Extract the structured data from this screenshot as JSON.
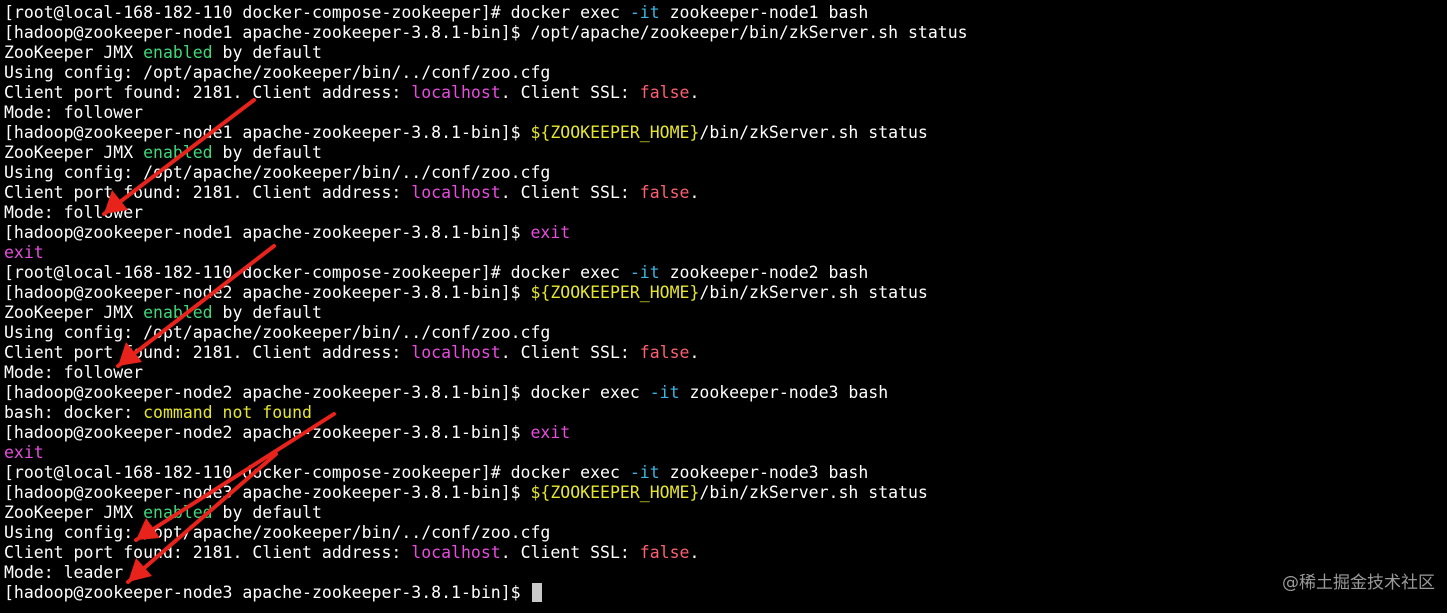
{
  "terminal": {
    "background": "#000000",
    "colors": {
      "default": "#ffffff",
      "green": "#3fd97a",
      "magenta": "#e84de0",
      "red": "#ff5f6e",
      "cyan": "#38b7e6",
      "yellow": "#e6e62e",
      "cursor": "#c8c8c8",
      "arrow": "#e8231b"
    },
    "lines": [
      {
        "segments": [
          {
            "text": "[root@local-168-182-110 docker-compose-zookeeper]# docker exec ",
            "color": "default"
          },
          {
            "text": "-it",
            "color": "cyan"
          },
          {
            "text": " zookeeper-node1 bash",
            "color": "default"
          }
        ]
      },
      {
        "segments": [
          {
            "text": "[hadoop@zookeeper-node1 apache-zookeeper-3.8.1-bin]$ /opt/apache/zookeeper/bin/zkServer.sh status",
            "color": "default"
          }
        ]
      },
      {
        "segments": [
          {
            "text": "ZooKeeper JMX ",
            "color": "default"
          },
          {
            "text": "enabled",
            "color": "green"
          },
          {
            "text": " by default",
            "color": "default"
          }
        ]
      },
      {
        "segments": [
          {
            "text": "Using config: /opt/apache/zookeeper/bin/../conf/zoo.cfg",
            "color": "default"
          }
        ]
      },
      {
        "segments": [
          {
            "text": "Client port found: 2181. Client address: ",
            "color": "default"
          },
          {
            "text": "localhost",
            "color": "magenta"
          },
          {
            "text": ". Client SSL: ",
            "color": "default"
          },
          {
            "text": "false",
            "color": "red"
          },
          {
            "text": ".",
            "color": "default"
          }
        ]
      },
      {
        "segments": [
          {
            "text": "Mode: follower",
            "color": "default"
          }
        ]
      },
      {
        "segments": [
          {
            "text": "[hadoop@zookeeper-node1 apache-zookeeper-3.8.1-bin]$ ",
            "color": "default"
          },
          {
            "text": "${ZOOKEEPER_HOME}",
            "color": "yellow"
          },
          {
            "text": "/bin/zkServer.sh status",
            "color": "default"
          }
        ]
      },
      {
        "segments": [
          {
            "text": "ZooKeeper JMX ",
            "color": "default"
          },
          {
            "text": "enabled",
            "color": "green"
          },
          {
            "text": " by default",
            "color": "default"
          }
        ]
      },
      {
        "segments": [
          {
            "text": "Using config: /opt/apache/zookeeper/bin/../conf/zoo.cfg",
            "color": "default"
          }
        ]
      },
      {
        "segments": [
          {
            "text": "Client port found: 2181. Client address: ",
            "color": "default"
          },
          {
            "text": "localhost",
            "color": "magenta"
          },
          {
            "text": ". Client SSL: ",
            "color": "default"
          },
          {
            "text": "false",
            "color": "red"
          },
          {
            "text": ".",
            "color": "default"
          }
        ]
      },
      {
        "segments": [
          {
            "text": "Mode: follower",
            "color": "default"
          }
        ]
      },
      {
        "segments": [
          {
            "text": "[hadoop@zookeeper-node1 apache-zookeeper-3.8.1-bin]$ ",
            "color": "default"
          },
          {
            "text": "exit",
            "color": "magenta"
          }
        ]
      },
      {
        "segments": [
          {
            "text": "exit",
            "color": "magenta"
          }
        ]
      },
      {
        "segments": [
          {
            "text": "[root@local-168-182-110 docker-compose-zookeeper]# docker exec ",
            "color": "default"
          },
          {
            "text": "-it",
            "color": "cyan"
          },
          {
            "text": " zookeeper-node2 bash",
            "color": "default"
          }
        ]
      },
      {
        "segments": [
          {
            "text": "[hadoop@zookeeper-node2 apache-zookeeper-3.8.1-bin]$ ",
            "color": "default"
          },
          {
            "text": "${ZOOKEEPER_HOME}",
            "color": "yellow"
          },
          {
            "text": "/bin/zkServer.sh status",
            "color": "default"
          }
        ]
      },
      {
        "segments": [
          {
            "text": "ZooKeeper JMX ",
            "color": "default"
          },
          {
            "text": "enabled",
            "color": "green"
          },
          {
            "text": " by default",
            "color": "default"
          }
        ]
      },
      {
        "segments": [
          {
            "text": "Using config: /opt/apache/zookeeper/bin/../conf/zoo.cfg",
            "color": "default"
          }
        ]
      },
      {
        "segments": [
          {
            "text": "Client port found: 2181. Client address: ",
            "color": "default"
          },
          {
            "text": "localhost",
            "color": "magenta"
          },
          {
            "text": ". Client SSL: ",
            "color": "default"
          },
          {
            "text": "false",
            "color": "red"
          },
          {
            "text": ".",
            "color": "default"
          }
        ]
      },
      {
        "segments": [
          {
            "text": "Mode: follower",
            "color": "default"
          }
        ]
      },
      {
        "segments": [
          {
            "text": "[hadoop@zookeeper-node2 apache-zookeeper-3.8.1-bin]$ docker exec ",
            "color": "default"
          },
          {
            "text": "-it",
            "color": "cyan"
          },
          {
            "text": " zookeeper-node3 bash",
            "color": "default"
          }
        ]
      },
      {
        "segments": [
          {
            "text": "bash: docker: ",
            "color": "default"
          },
          {
            "text": "command not found",
            "color": "yellow"
          }
        ]
      },
      {
        "segments": [
          {
            "text": "[hadoop@zookeeper-node2 apache-zookeeper-3.8.1-bin]$ ",
            "color": "default"
          },
          {
            "text": "exit",
            "color": "magenta"
          }
        ]
      },
      {
        "segments": [
          {
            "text": "exit",
            "color": "magenta"
          }
        ]
      },
      {
        "segments": [
          {
            "text": "[root@local-168-182-110 docker-compose-zookeeper]# docker exec ",
            "color": "default"
          },
          {
            "text": "-it",
            "color": "cyan"
          },
          {
            "text": " zookeeper-node3 bash",
            "color": "default"
          }
        ]
      },
      {
        "segments": [
          {
            "text": "[hadoop@zookeeper-node3 apache-zookeeper-3.8.1-bin]$ ",
            "color": "default"
          },
          {
            "text": "${ZOOKEEPER_HOME}",
            "color": "yellow"
          },
          {
            "text": "/bin/zkServer.sh status",
            "color": "default"
          }
        ]
      },
      {
        "segments": [
          {
            "text": "ZooKeeper JMX ",
            "color": "default"
          },
          {
            "text": "enabled",
            "color": "green"
          },
          {
            "text": " by default",
            "color": "default"
          }
        ]
      },
      {
        "segments": [
          {
            "text": "Using config: /opt/apache/zookeeper/bin/../conf/zoo.cfg",
            "color": "default"
          }
        ]
      },
      {
        "segments": [
          {
            "text": "Client port found: 2181. Client address: ",
            "color": "default"
          },
          {
            "text": "localhost",
            "color": "magenta"
          },
          {
            "text": ". Client SSL: ",
            "color": "default"
          },
          {
            "text": "false",
            "color": "red"
          },
          {
            "text": ".",
            "color": "default"
          }
        ]
      },
      {
        "segments": [
          {
            "text": "Mode: leader",
            "color": "default"
          }
        ]
      },
      {
        "segments": [
          {
            "text": "[hadoop@zookeeper-node3 apache-zookeeper-3.8.1-bin]$ ",
            "color": "default"
          }
        ],
        "cursor": true
      }
    ]
  },
  "watermark": {
    "text": "@稀土掘金技术社区"
  },
  "annotations": {
    "arrow_icon": "red-arrow-icon",
    "count": 4
  }
}
